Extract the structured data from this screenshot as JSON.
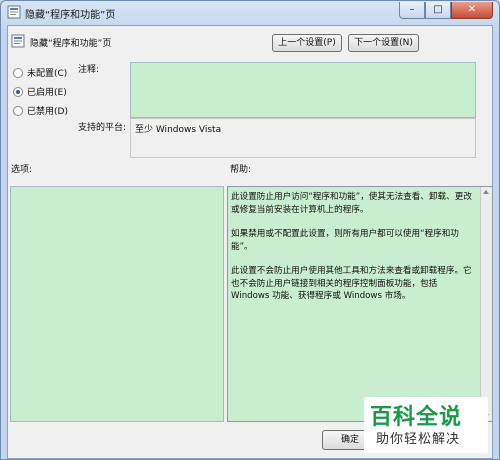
{
  "window": {
    "title": "隐藏“程序和功能”页",
    "controls": {
      "minimize": "–",
      "maximize": "□",
      "close": "✕"
    }
  },
  "header": {
    "policy_title": "隐藏“程序和功能”页",
    "prev_setting": "上一个设置(P)",
    "next_setting": "下一个设置(N)"
  },
  "state": {
    "options": [
      {
        "label": "未配置(C)",
        "checked": false
      },
      {
        "label": "已启用(E)",
        "checked": true
      },
      {
        "label": "已禁用(D)",
        "checked": false
      }
    ]
  },
  "comment": {
    "label": "注释:",
    "value": ""
  },
  "platform": {
    "label": "支持的平台:",
    "value": "至少 Windows Vista"
  },
  "options_section": {
    "label": "选项:"
  },
  "help_section": {
    "label": "帮助:",
    "paragraphs": [
      "此设置防止用户访问“程序和功能”，使其无法查看、卸载、更改或修复当前安装在计算机上的程序。",
      "如果禁用或不配置此设置，则所有用户都可以使用“程序和功能”。",
      "此设置不会防止用户使用其他工具和方法来查看或卸载程序。它也不会防止用户链接到相关的程序控制面板功能，包括 Windows 功能、获得程序或 Windows 市场。"
    ]
  },
  "footer": {
    "ok": "确定"
  },
  "watermark": {
    "main": "百科全说",
    "sub": "助你轻松解决"
  },
  "colors": {
    "accent": "#2a5db0",
    "panel_green": "#c8edcf",
    "watermark_green": "#1a9a48"
  }
}
